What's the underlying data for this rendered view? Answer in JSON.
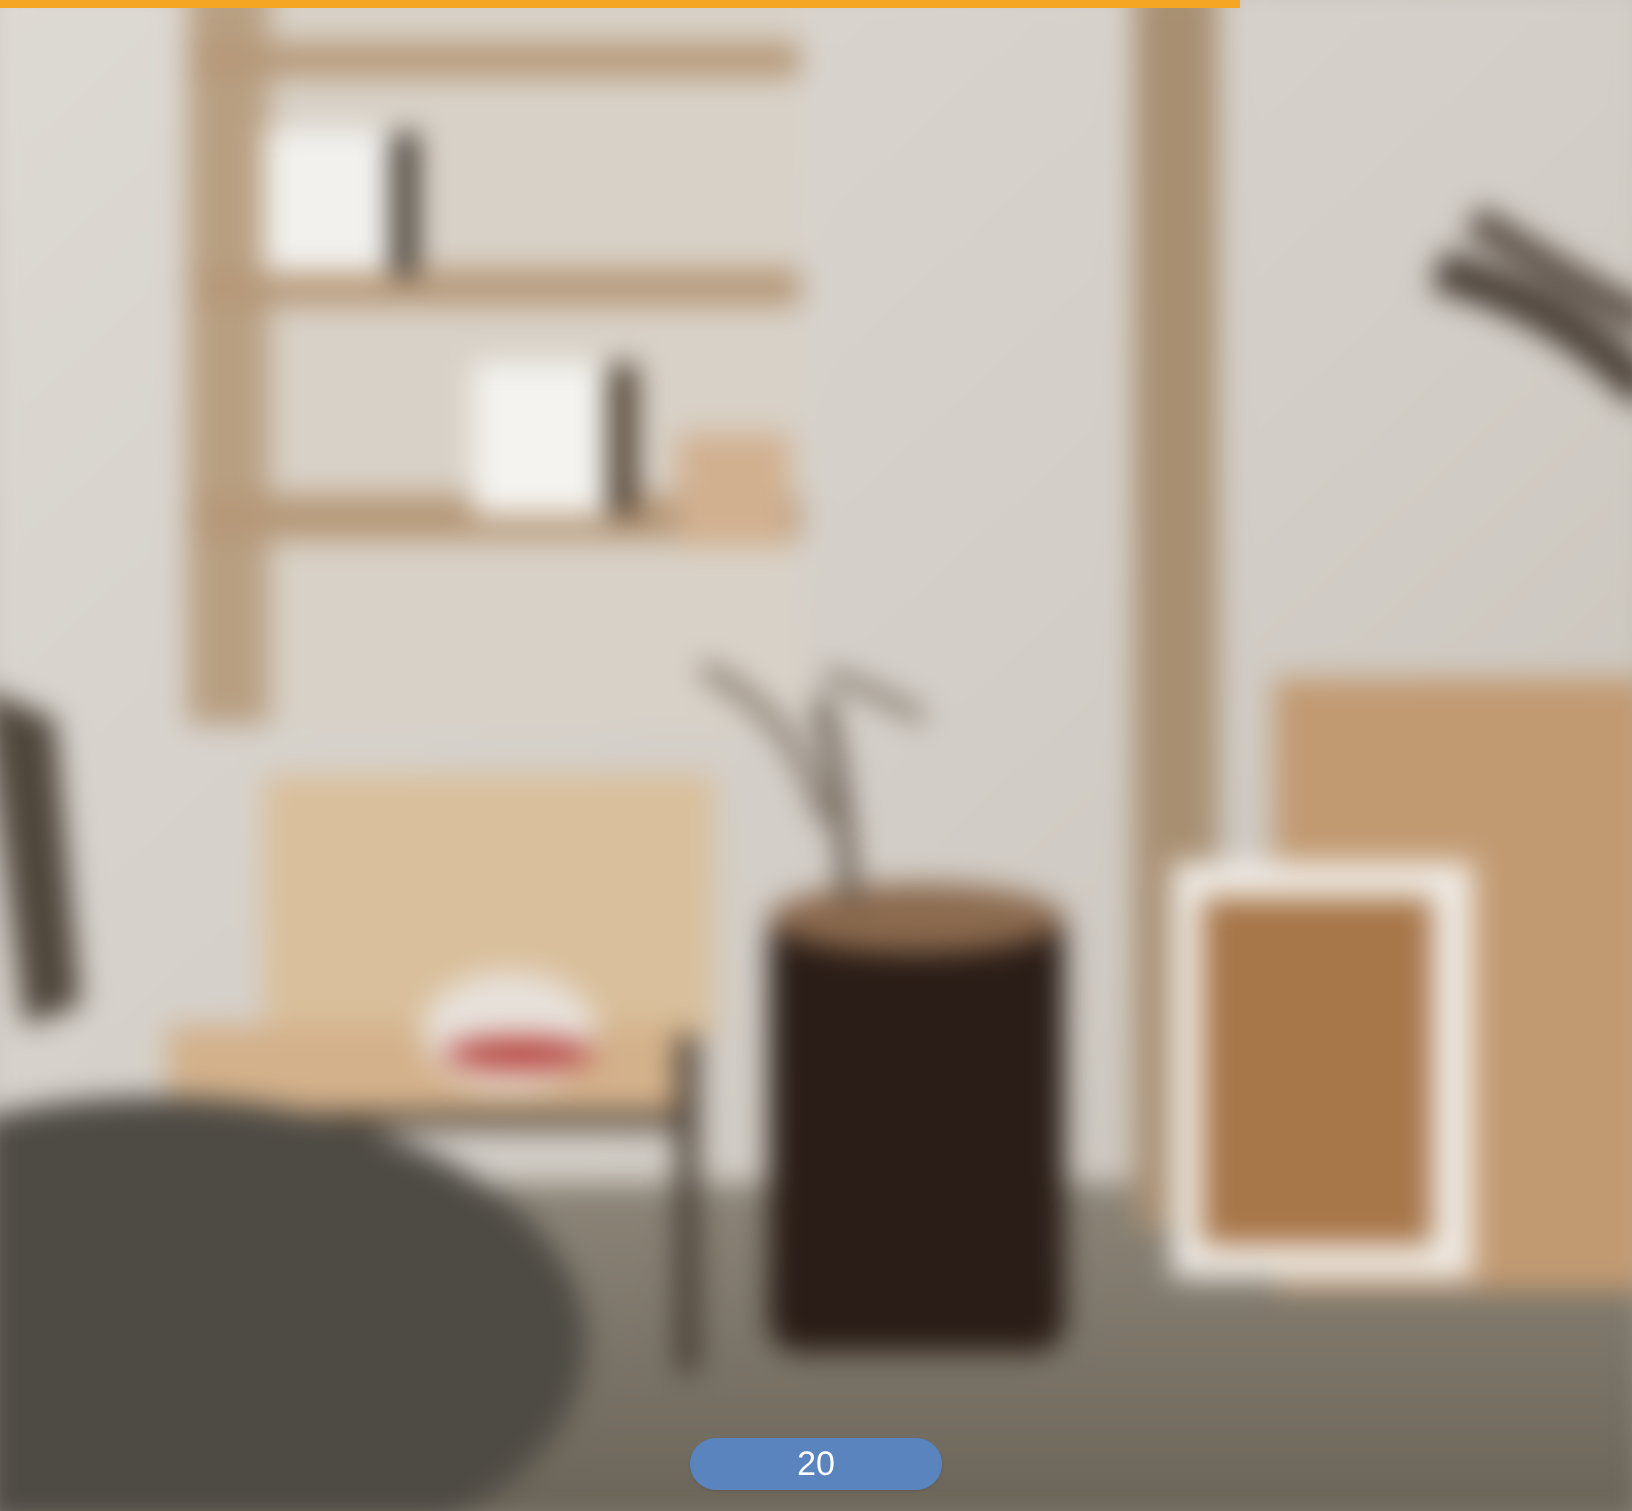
{
  "progress": {
    "fraction": 0.76,
    "color": "#f5a623"
  },
  "counter": {
    "value": "20",
    "color": "#5a84bd"
  },
  "scene": {
    "description_icon": "background-photo"
  }
}
